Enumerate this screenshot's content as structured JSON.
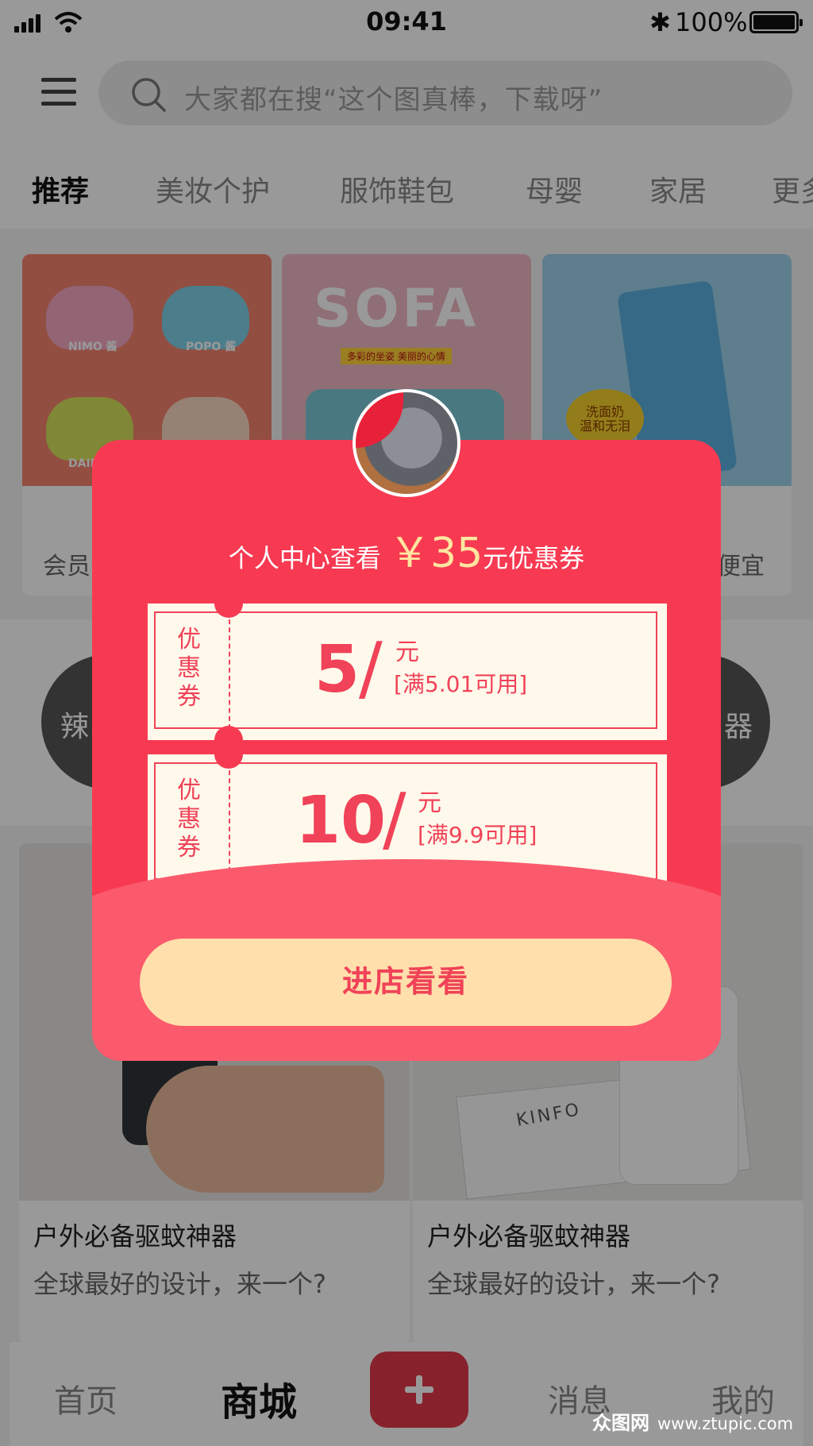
{
  "status_bar": {
    "time": "09:41",
    "battery": "100%"
  },
  "search": {
    "placeholder": "大家都在搜“这个图真棒，下载呀”"
  },
  "tabs": [
    "推荐",
    "美妆个护",
    "服饰鞋包",
    "母婴",
    "家居",
    "更多"
  ],
  "cards": {
    "card1": {
      "caption": "会员",
      "labels": [
        "NIMO 酱",
        "POPO 酱",
        "DAIBI"
      ]
    },
    "card2": {
      "caption": "",
      "title": "SOFA",
      "tagline": "多彩的坐姿 美丽的心情"
    },
    "card3": {
      "caption": "便宜",
      "tag": "洗面奶\n温和无泪"
    }
  },
  "rounds": {
    "left": "辣",
    "right": "器"
  },
  "feed": [
    {
      "title": "户外必备驱蚊神器",
      "subtitle": "全球最好的设计，来一个?"
    },
    {
      "title": "户外必备驱蚊神器",
      "subtitle": "全球最好的设计，来一个?",
      "brand": "KINFO"
    }
  ],
  "bottom_nav": {
    "home": "首页",
    "mall": "商城",
    "messages": "消息",
    "mine": "我的"
  },
  "watermark": {
    "brand": "众图网",
    "url": "www.ztupic.com"
  },
  "popup": {
    "title_prefix": "个人中心查看",
    "amount": "￥35",
    "title_suffix": "元优惠券",
    "coupons": [
      {
        "label": "优惠券",
        "value": "5",
        "unit": "元",
        "condition": "[满5.01可用]"
      },
      {
        "label": "优惠券",
        "value": "10",
        "unit": "元",
        "condition": "[满9.9可用]"
      }
    ],
    "button": "进店看看"
  },
  "colors": {
    "accent": "#f73a52",
    "button_bg": "#ffdfab",
    "coupon_text": "#f04258"
  }
}
